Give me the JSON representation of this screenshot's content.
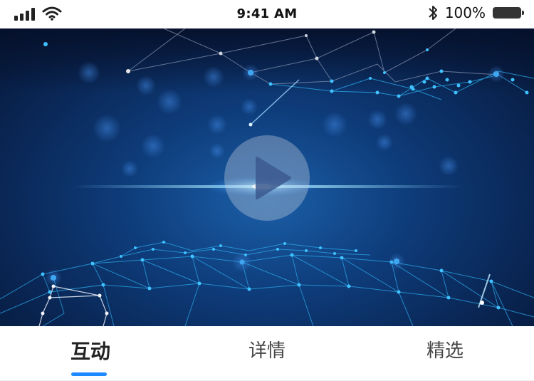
{
  "status_bar": {
    "time": "9:41 AM",
    "battery_percent": "100%",
    "icons": [
      "signal-icon",
      "wifi-icon",
      "bluetooth-icon",
      "battery-icon"
    ]
  },
  "video": {
    "play_icon": "play-icon"
  },
  "tabs": [
    {
      "label": "互动",
      "active": true
    },
    {
      "label": "详情",
      "active": false
    },
    {
      "label": "精选",
      "active": false
    }
  ],
  "colors": {
    "accent": "#1e88ff",
    "video_bg": "#0e3c7a"
  }
}
